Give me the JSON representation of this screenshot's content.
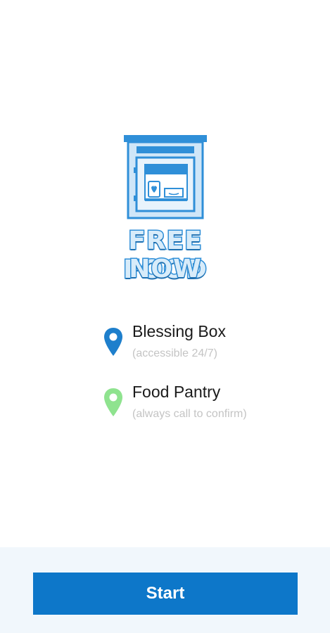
{
  "logo": {
    "line1": "FREE FOOD",
    "line2": "NOW",
    "icon": "blessing-box-icon"
  },
  "legend": {
    "items": [
      {
        "label": "Blessing Box",
        "sublabel": "(accessible 24/7)",
        "icon": "map-pin-icon",
        "color": "#1e7fcc"
      },
      {
        "label": "Food Pantry",
        "sublabel": "(always call to confirm)",
        "icon": "map-pin-icon",
        "color": "#8fe38f"
      }
    ]
  },
  "footer": {
    "start_label": "Start"
  },
  "colors": {
    "primary": "#0d77c9",
    "footer_bg": "#f1f7fc",
    "sublabel": "#c4c4c4"
  }
}
